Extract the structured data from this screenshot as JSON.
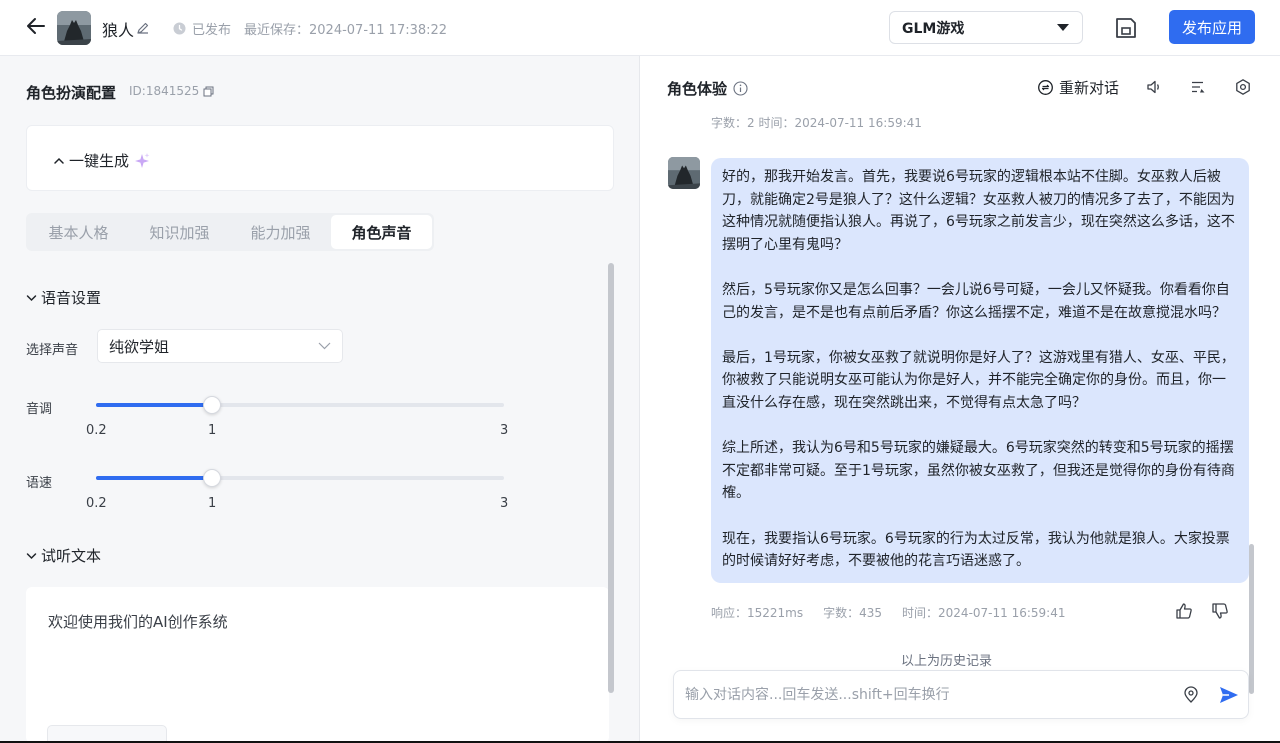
{
  "header": {
    "app_name": "狼人",
    "publish_status": "已发布",
    "last_saved": "最近保存：2024-07-11 17:38:22",
    "model": "GLM游戏",
    "publish_button": "发布应用"
  },
  "config": {
    "title": "角色扮演配置",
    "id": "ID:1841525",
    "one_click_generate": "一键生成",
    "tabs": [
      "基本人格",
      "知识加强",
      "能力加强",
      "角色声音"
    ],
    "active_tab": "角色声音",
    "voice_section": "语音设置",
    "voice_label": "选择声音",
    "voice_value": "纯欲学姐",
    "pitch_label": "音调",
    "pitch": {
      "min": "0.2",
      "current": "1",
      "max": "3",
      "value": 1
    },
    "speed_label": "语速",
    "speed": {
      "min": "0.2",
      "current": "1",
      "max": "3",
      "value": 1
    },
    "preview_section": "试听文本",
    "preview_text": "欢迎使用我们的AI创作系统"
  },
  "chat": {
    "title": "角色体验",
    "restart": "重新对话",
    "prev_meta": "字数：2    时间：2024-07-11 16:59:41",
    "paragraphs": [
      "好的，那我开始发言。首先，我要说6号玩家的逻辑根本站不住脚。女巫救人后被刀，就能确定2号是狼人了？这什么逻辑？女巫救人被刀的情况多了去了，不能因为这种情况就随便指认狼人。再说了，6号玩家之前发言少，现在突然这么多话，这不摆明了心里有鬼吗？",
      "然后，5号玩家你又是怎么回事？一会儿说6号可疑，一会儿又怀疑我。你看看你自己的发言，是不是也有点前后矛盾？你这么摇摆不定，难道不是在故意搅混水吗？",
      "最后，1号玩家，你被女巫救了就说明你是好人了？这游戏里有猎人、女巫、平民，你被救了只能说明女巫可能认为你是好人，并不能完全确定你的身份。而且，你一直没什么存在感，现在突然跳出来，不觉得有点太急了吗？",
      "综上所述，我认为6号和5号玩家的嫌疑最大。6号玩家突然的转变和5号玩家的摇摆不定都非常可疑。至于1号玩家，虽然你被女巫救了，但我还是觉得你的身份有待商榷。",
      "现在，我要指认6号玩家。6号玩家的行为太过反常，我认为他就是狼人。大家投票的时候请好好考虑，不要被他的花言巧语迷惑了。"
    ],
    "meta_response": "响应：15221ms",
    "meta_chars": "字数：435",
    "meta_time": "时间：2024-07-11 16:59:41",
    "history_note": "以上为历史记录",
    "input_placeholder": "输入对话内容...回车发送...shift+回车换行"
  },
  "colors": {
    "accent": "#2f6cf0",
    "bubble": "#dbe6fd",
    "panel_bg": "#f6f7f9"
  }
}
